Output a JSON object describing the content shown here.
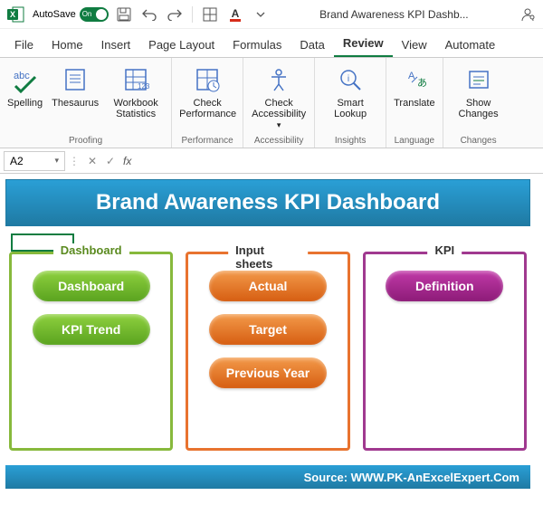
{
  "titlebar": {
    "autosave_label": "AutoSave",
    "autosave_state": "On",
    "title": "Brand Awareness KPI Dashb..."
  },
  "tabs": {
    "file": "File",
    "home": "Home",
    "insert": "Insert",
    "page_layout": "Page Layout",
    "formulas": "Formulas",
    "data": "Data",
    "review": "Review",
    "view": "View",
    "automate": "Automate"
  },
  "ribbon": {
    "proofing": {
      "group": "Proofing",
      "spelling": "Spelling",
      "thesaurus": "Thesaurus",
      "workbook_stats": "Workbook Statistics"
    },
    "performance": {
      "group": "Performance",
      "check_perf": "Check Performance"
    },
    "accessibility": {
      "group": "Accessibility",
      "check_acc": "Check Accessibility"
    },
    "insights": {
      "group": "Insights",
      "smart_lookup": "Smart Lookup"
    },
    "language": {
      "group": "Language",
      "translate": "Translate"
    },
    "changes": {
      "group": "Changes",
      "show_changes": "Show Changes"
    }
  },
  "formulabar": {
    "namebox": "A2",
    "fx": "fx"
  },
  "dashboard": {
    "title": "Brand Awareness KPI Dashboard",
    "panels": {
      "dashboard": {
        "title": "Dashboard",
        "btn1": "Dashboard",
        "btn2": "KPI Trend"
      },
      "inputs": {
        "title": "Input sheets",
        "btn1": "Actual",
        "btn2": "Target",
        "btn3": "Previous Year"
      },
      "kpi": {
        "title": "KPI",
        "btn1": "Definition"
      }
    },
    "source": "Source: WWW.PK-AnExcelExpert.Com"
  }
}
